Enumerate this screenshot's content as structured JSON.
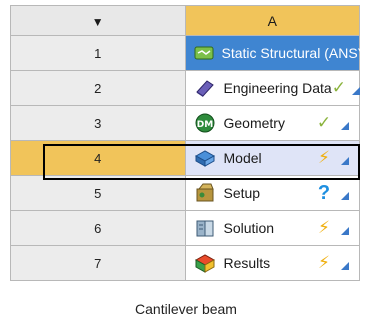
{
  "system": {
    "column_header": "A",
    "header_arrow": "▼",
    "caption": "Cantilever beam",
    "rows": [
      {
        "num": "1",
        "label": "Static Structural (ANSYS)",
        "icon": "static-structural-icon",
        "status": "",
        "status_icon": ""
      },
      {
        "num": "2",
        "label": "Engineering Data",
        "icon": "engineering-data-icon",
        "status": "✓",
        "status_icon": "checkmark-icon"
      },
      {
        "num": "3",
        "label": "Geometry",
        "icon": "geometry-icon",
        "status": "✓",
        "status_icon": "checkmark-icon"
      },
      {
        "num": "4",
        "label": "Model",
        "icon": "model-icon",
        "status": "⚡",
        "status_icon": "refresh-required-icon"
      },
      {
        "num": "5",
        "label": "Setup",
        "icon": "setup-icon",
        "status": "?",
        "status_icon": "question-icon"
      },
      {
        "num": "6",
        "label": "Solution",
        "icon": "solution-icon",
        "status": "⚡",
        "status_icon": "refresh-required-icon"
      },
      {
        "num": "7",
        "label": "Results",
        "icon": "results-icon",
        "status": "⚡",
        "status_icon": "refresh-required-icon"
      }
    ]
  },
  "colors": {
    "header": "#f1c45a",
    "title_row": "#3f85d1",
    "selected_row": "#dfe4f7"
  }
}
